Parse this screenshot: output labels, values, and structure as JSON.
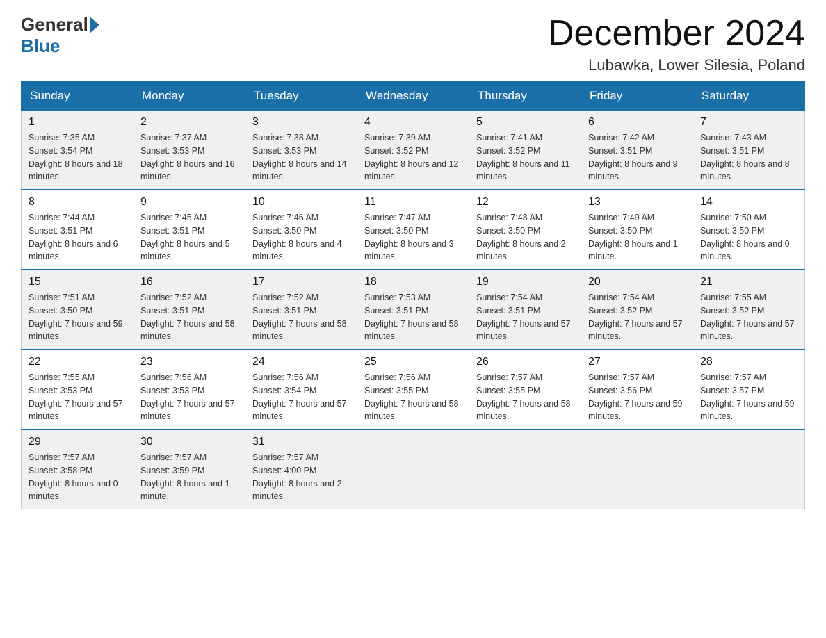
{
  "logo": {
    "general": "General",
    "blue": "Blue"
  },
  "title": "December 2024",
  "location": "Lubawka, Lower Silesia, Poland",
  "days_header": [
    "Sunday",
    "Monday",
    "Tuesday",
    "Wednesday",
    "Thursday",
    "Friday",
    "Saturday"
  ],
  "weeks": [
    [
      {
        "day": "1",
        "sunrise": "7:35 AM",
        "sunset": "3:54 PM",
        "daylight": "8 hours and 18 minutes."
      },
      {
        "day": "2",
        "sunrise": "7:37 AM",
        "sunset": "3:53 PM",
        "daylight": "8 hours and 16 minutes."
      },
      {
        "day": "3",
        "sunrise": "7:38 AM",
        "sunset": "3:53 PM",
        "daylight": "8 hours and 14 minutes."
      },
      {
        "day": "4",
        "sunrise": "7:39 AM",
        "sunset": "3:52 PM",
        "daylight": "8 hours and 12 minutes."
      },
      {
        "day": "5",
        "sunrise": "7:41 AM",
        "sunset": "3:52 PM",
        "daylight": "8 hours and 11 minutes."
      },
      {
        "day": "6",
        "sunrise": "7:42 AM",
        "sunset": "3:51 PM",
        "daylight": "8 hours and 9 minutes."
      },
      {
        "day": "7",
        "sunrise": "7:43 AM",
        "sunset": "3:51 PM",
        "daylight": "8 hours and 8 minutes."
      }
    ],
    [
      {
        "day": "8",
        "sunrise": "7:44 AM",
        "sunset": "3:51 PM",
        "daylight": "8 hours and 6 minutes."
      },
      {
        "day": "9",
        "sunrise": "7:45 AM",
        "sunset": "3:51 PM",
        "daylight": "8 hours and 5 minutes."
      },
      {
        "day": "10",
        "sunrise": "7:46 AM",
        "sunset": "3:50 PM",
        "daylight": "8 hours and 4 minutes."
      },
      {
        "day": "11",
        "sunrise": "7:47 AM",
        "sunset": "3:50 PM",
        "daylight": "8 hours and 3 minutes."
      },
      {
        "day": "12",
        "sunrise": "7:48 AM",
        "sunset": "3:50 PM",
        "daylight": "8 hours and 2 minutes."
      },
      {
        "day": "13",
        "sunrise": "7:49 AM",
        "sunset": "3:50 PM",
        "daylight": "8 hours and 1 minute."
      },
      {
        "day": "14",
        "sunrise": "7:50 AM",
        "sunset": "3:50 PM",
        "daylight": "8 hours and 0 minutes."
      }
    ],
    [
      {
        "day": "15",
        "sunrise": "7:51 AM",
        "sunset": "3:50 PM",
        "daylight": "7 hours and 59 minutes."
      },
      {
        "day": "16",
        "sunrise": "7:52 AM",
        "sunset": "3:51 PM",
        "daylight": "7 hours and 58 minutes."
      },
      {
        "day": "17",
        "sunrise": "7:52 AM",
        "sunset": "3:51 PM",
        "daylight": "7 hours and 58 minutes."
      },
      {
        "day": "18",
        "sunrise": "7:53 AM",
        "sunset": "3:51 PM",
        "daylight": "7 hours and 58 minutes."
      },
      {
        "day": "19",
        "sunrise": "7:54 AM",
        "sunset": "3:51 PM",
        "daylight": "7 hours and 57 minutes."
      },
      {
        "day": "20",
        "sunrise": "7:54 AM",
        "sunset": "3:52 PM",
        "daylight": "7 hours and 57 minutes."
      },
      {
        "day": "21",
        "sunrise": "7:55 AM",
        "sunset": "3:52 PM",
        "daylight": "7 hours and 57 minutes."
      }
    ],
    [
      {
        "day": "22",
        "sunrise": "7:55 AM",
        "sunset": "3:53 PM",
        "daylight": "7 hours and 57 minutes."
      },
      {
        "day": "23",
        "sunrise": "7:56 AM",
        "sunset": "3:53 PM",
        "daylight": "7 hours and 57 minutes."
      },
      {
        "day": "24",
        "sunrise": "7:56 AM",
        "sunset": "3:54 PM",
        "daylight": "7 hours and 57 minutes."
      },
      {
        "day": "25",
        "sunrise": "7:56 AM",
        "sunset": "3:55 PM",
        "daylight": "7 hours and 58 minutes."
      },
      {
        "day": "26",
        "sunrise": "7:57 AM",
        "sunset": "3:55 PM",
        "daylight": "7 hours and 58 minutes."
      },
      {
        "day": "27",
        "sunrise": "7:57 AM",
        "sunset": "3:56 PM",
        "daylight": "7 hours and 59 minutes."
      },
      {
        "day": "28",
        "sunrise": "7:57 AM",
        "sunset": "3:57 PM",
        "daylight": "7 hours and 59 minutes."
      }
    ],
    [
      {
        "day": "29",
        "sunrise": "7:57 AM",
        "sunset": "3:58 PM",
        "daylight": "8 hours and 0 minutes."
      },
      {
        "day": "30",
        "sunrise": "7:57 AM",
        "sunset": "3:59 PM",
        "daylight": "8 hours and 1 minute."
      },
      {
        "day": "31",
        "sunrise": "7:57 AM",
        "sunset": "4:00 PM",
        "daylight": "8 hours and 2 minutes."
      },
      null,
      null,
      null,
      null
    ]
  ],
  "labels": {
    "sunrise": "Sunrise:",
    "sunset": "Sunset:",
    "daylight": "Daylight:"
  }
}
